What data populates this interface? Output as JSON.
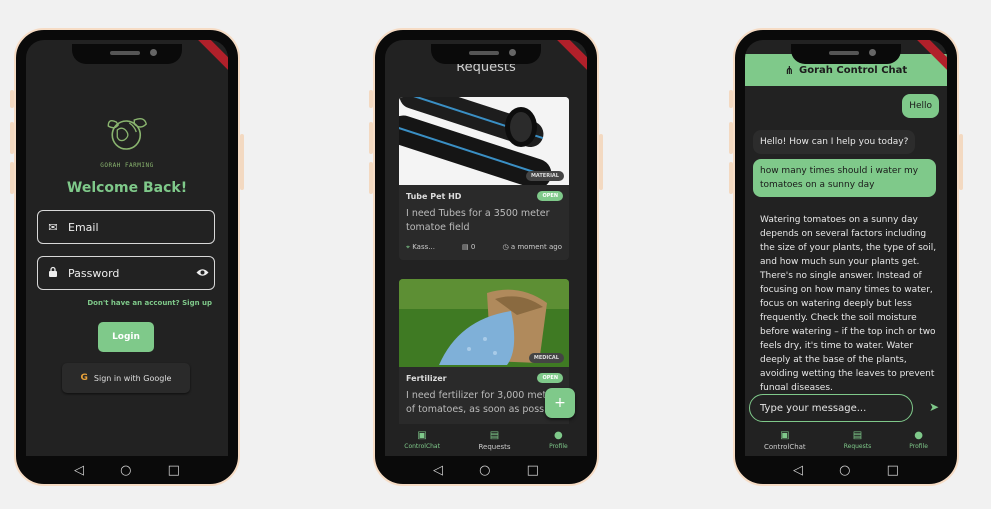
{
  "login": {
    "logo_text": "GORAH FARMING",
    "welcome": "Welcome Back!",
    "email_placeholder": "Email",
    "password_placeholder": "Password",
    "signup_text": "Don't have an account? Sign up",
    "login_label": "Login",
    "google_label": "Sign in with Google"
  },
  "requests": {
    "title": "Requests",
    "cards": [
      {
        "tag": "MATERIAL",
        "name": "Tube Pet HD",
        "status": "OPEN",
        "description": "I need Tubes for a 3500 meter tomatoe field",
        "location": "Kass...",
        "comments": "0",
        "time": "a moment ago"
      },
      {
        "tag": "MEDICAL",
        "name": "Fertilizer",
        "status": "OPEN",
        "description": "I need fertilizer for 3,000 meters of tomatoes, as soon as possible"
      }
    ],
    "fab": "+",
    "nav": [
      {
        "label": "ControlChat"
      },
      {
        "label": "Requests"
      },
      {
        "label": "Profile"
      }
    ]
  },
  "chat": {
    "title": "Gorah Control Chat",
    "messages": [
      {
        "from": "user",
        "text": "Hello"
      },
      {
        "from": "bot",
        "text": "Hello! How can I help you today?"
      },
      {
        "from": "user",
        "text": "how many times should i water my tomatoes on a sunny day"
      },
      {
        "from": "bot",
        "text": "Watering tomatoes on a sunny day depends on several factors including the size of your plants, the type of soil, and how much sun your plants get.  There's no single answer.  Instead of focusing on how many times to water, focus on watering deeply but less frequently. Check the soil moisture before watering – if the top inch or two feels dry, it's time to water.  Water deeply at the base of the plants, avoiding wetting the leaves to prevent fungal diseases."
      }
    ],
    "input_placeholder": "Type your message...",
    "nav": [
      {
        "label": "ControlChat"
      },
      {
        "label": "Requests"
      },
      {
        "label": "Profile"
      }
    ]
  },
  "colors": {
    "accent": "#7fc98a",
    "background": "#222222"
  }
}
